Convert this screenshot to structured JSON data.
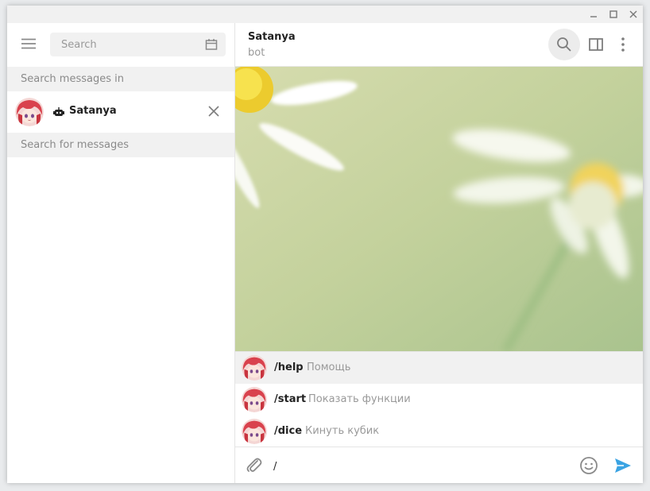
{
  "window": {
    "controls": [
      "minimize-icon",
      "maximize-icon",
      "close-icon"
    ]
  },
  "sidebar": {
    "search_placeholder": "Search",
    "search_in_label": "Search messages in",
    "chat_name": "Satanya",
    "search_for_label": "Search for messages"
  },
  "chat": {
    "title": "Satanya",
    "subtitle": "bot"
  },
  "commands": [
    {
      "name": "/help",
      "description": "Помощь"
    },
    {
      "name": "/start",
      "description": "Показать функции"
    },
    {
      "name": "/dice",
      "description": "Кинуть кубик"
    }
  ],
  "composer": {
    "value": "/"
  },
  "colors": {
    "accent": "#3aa3e3",
    "icon": "#7d7d7d",
    "panel": "#f1f1f1"
  }
}
